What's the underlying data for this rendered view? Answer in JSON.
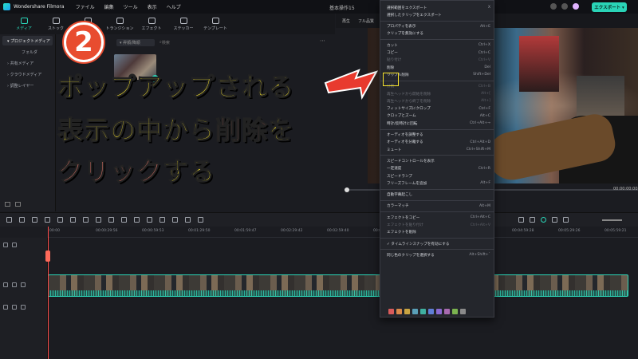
{
  "app": {
    "name": "Wondershare Filmora",
    "menu": [
      "ファイル",
      "編集",
      "ツール",
      "表示",
      "ヘルプ"
    ],
    "project_title": "基本操作15",
    "export_label": "エクスポート ▾"
  },
  "toolbar": {
    "tabs": [
      {
        "label": "メディア",
        "icon": "media-icon"
      },
      {
        "label": "ストック",
        "icon": "stock-icon"
      },
      {
        "label": "オーディオ",
        "icon": "audio-icon"
      },
      {
        "label": "トランジション",
        "icon": "transition-icon"
      },
      {
        "label": "エフェクト",
        "icon": "effects-icon"
      },
      {
        "label": "ステッカー",
        "icon": "sticker-icon"
      },
      {
        "label": "テンプレート",
        "icon": "template-icon"
      }
    ]
  },
  "sidebar": {
    "items": [
      {
        "label": "▾ プロジェクトメディア",
        "active": true
      },
      {
        "label": "フォルダ",
        "sub": true
      },
      {
        "label": "› 共有メディア"
      },
      {
        "label": "› クラウドメディア"
      },
      {
        "label": "› 調整レイヤー"
      }
    ]
  },
  "media": {
    "sort_label": "▾ 昇順/降順",
    "search_placeholder": "検索",
    "thumb_caption": "基本操作15"
  },
  "overlay": {
    "step_number": "2",
    "line1": "ポップアップされる",
    "line2_a": "表示の中から",
    "line2_red": "削除",
    "line2_b": "を",
    "line3_red": "クリック",
    "line3_b": "する"
  },
  "player": {
    "tabs": [
      "再生",
      "フル品質"
    ],
    "timecode": "00:00:00:00"
  },
  "timeline": {
    "ruler": [
      "00:00",
      "00:00:29:56",
      "00:00:59:53",
      "00:01:29:50",
      "00:01:59:47",
      "00:02:29:42",
      "00:02:59:40",
      "00:03:29:37",
      "00:03:59:34",
      "00:04:29:31",
      "00:04:59:28",
      "00:05:29:26",
      "00:05:59:21"
    ]
  },
  "context_menu": {
    "items": [
      {
        "label": "選択範囲をエクスポート",
        "shortcut": "X"
      },
      {
        "label": "選択したクリップをエクスポート",
        "shortcut": ""
      },
      {
        "sep": true
      },
      {
        "label": "プロパティを表示",
        "shortcut": "Alt+E"
      },
      {
        "label": "クリップを無効にする",
        "shortcut": ""
      },
      {
        "sep": true
      },
      {
        "label": "カット",
        "shortcut": "Ctrl+X"
      },
      {
        "label": "コピー",
        "shortcut": "Ctrl+C"
      },
      {
        "label": "貼り付け",
        "shortcut": "Ctrl+V",
        "disabled": true
      },
      {
        "label": "削除",
        "shortcut": "Del"
      },
      {
        "label": "リップル削除",
        "shortcut": "Shift+Del"
      },
      {
        "sep": true
      },
      {
        "label": "分割",
        "shortcut": "Ctrl+B",
        "disabled": true
      },
      {
        "label": "再生ヘッドから開始を削除",
        "shortcut": "Alt+[",
        "disabled": true
      },
      {
        "label": "再生ヘッドから終了を削除",
        "shortcut": "Alt+]",
        "disabled": true
      },
      {
        "label": "フィットサイズにクロップ",
        "shortcut": "Ctrl+F"
      },
      {
        "label": "クロップとズーム",
        "shortcut": "Alt+C"
      },
      {
        "label": "時計/反時計に回転",
        "shortcut": "Ctrl+Alt+→"
      },
      {
        "sep": true
      },
      {
        "label": "オーディオを調整する",
        "shortcut": ""
      },
      {
        "label": "オーディオを分離する",
        "shortcut": "Ctrl+Alt+D"
      },
      {
        "label": "ミュート",
        "shortcut": "Ctrl+Shift+M"
      },
      {
        "sep": true
      },
      {
        "label": "スピードコントロールを表示",
        "shortcut": ""
      },
      {
        "label": "一定速度",
        "shortcut": "Ctrl+R"
      },
      {
        "label": "スピードランプ",
        "shortcut": ""
      },
      {
        "label": "フリーズフレームを追加",
        "shortcut": "Alt+F"
      },
      {
        "sep": true
      },
      {
        "label": "自動字幕起こし",
        "shortcut": ""
      },
      {
        "sep": true
      },
      {
        "label": "カラーマッチ",
        "shortcut": "Alt+M"
      },
      {
        "sep": true
      },
      {
        "label": "エフェクトをコピー",
        "shortcut": "Ctrl+Alt+C"
      },
      {
        "label": "エフェクトを貼り付け",
        "shortcut": "Ctrl+Alt+V",
        "disabled": true
      },
      {
        "label": "エフェクトを削除",
        "shortcut": ""
      },
      {
        "sep": true
      },
      {
        "label": "✓ タイムラインスナップを有効にする",
        "shortcut": ""
      },
      {
        "sep": true
      },
      {
        "label": "同じ色のクリップを選択する",
        "shortcut": "Alt+Shift+`"
      }
    ],
    "swatch_colors": [
      "#d95b5b",
      "#d98a4a",
      "#c9a441",
      "#5aa0b8",
      "#3fb0a0",
      "#5f7fd6",
      "#8a6ad1",
      "#a86ab0",
      "#7bb34f",
      "#8a8a8a"
    ]
  }
}
